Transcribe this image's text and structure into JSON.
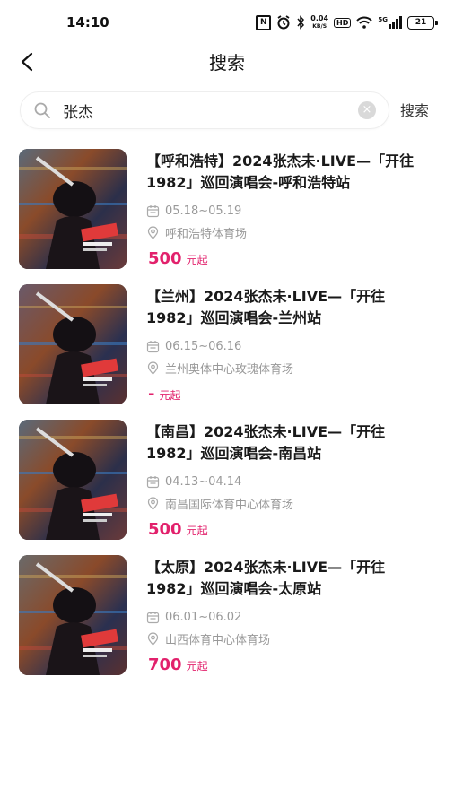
{
  "status_bar": {
    "time": "14:10",
    "nfc": "N",
    "speed_value": "0.04",
    "speed_unit": "KB/S",
    "hd": "HD",
    "signal_label": "5G",
    "battery": "21"
  },
  "header": {
    "title": "搜索",
    "back_icon": "chevron-left-icon"
  },
  "search": {
    "query": "张杰",
    "button_label": "搜索",
    "search_icon": "search-icon",
    "clear_icon": "clear-icon"
  },
  "colors": {
    "accent": "#e2216c",
    "meta_text": "#999999"
  },
  "results": [
    {
      "title": "【呼和浩特】2024张杰未·LIVE—「开往1982」巡回演唱会-呼和浩特站",
      "date": "05.18~05.19",
      "venue": "呼和浩特体育场",
      "price": "500",
      "price_unit": "元起"
    },
    {
      "title": "【兰州】2024张杰未·LIVE—「开往1982」巡回演唱会-兰州站",
      "date": "06.15~06.16",
      "venue": "兰州奥体中心玫瑰体育场",
      "price": "-",
      "price_unit": "元起"
    },
    {
      "title": "【南昌】2024张杰未·LIVE—「开往1982」巡回演唱会-南昌站",
      "date": "04.13~04.14",
      "venue": "南昌国际体育中心体育场",
      "price": "500",
      "price_unit": "元起"
    },
    {
      "title": "【太原】2024张杰未·LIVE—「开往1982」巡回演唱会-太原站",
      "date": "06.01~06.02",
      "venue": "山西体育中心体育场",
      "price": "700",
      "price_unit": "元起"
    }
  ]
}
